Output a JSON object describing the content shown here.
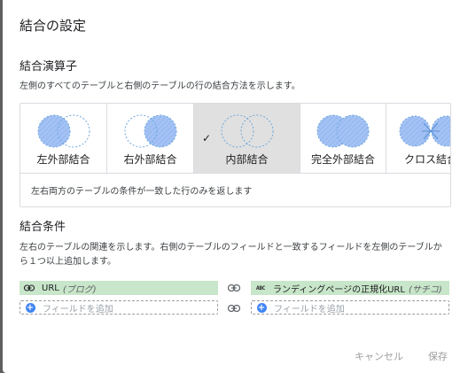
{
  "dialog": {
    "title": "結合の設定"
  },
  "operator": {
    "section_title": "結合演算子",
    "description": "左側のすべてのテーブルと右側のテーブルの行の結合方法を示します。",
    "types": [
      {
        "label": "左外部結合",
        "icon": "left-outer-join-icon",
        "selected": false
      },
      {
        "label": "右外部結合",
        "icon": "right-outer-join-icon",
        "selected": false
      },
      {
        "label": "内部結合",
        "icon": "inner-join-icon",
        "selected": true
      },
      {
        "label": "完全外部結合",
        "icon": "full-outer-join-icon",
        "selected": false
      },
      {
        "label": "クロス結合",
        "icon": "cross-join-icon",
        "selected": false
      }
    ],
    "selected_description": "左右両方のテーブルの条件が一致した行のみを返します",
    "check_mark": "✓"
  },
  "conditions": {
    "section_title": "結合条件",
    "description": "左右のテーブルの関連を示します。右側のテーブルのフィールドと一致するフィールドを左側のテーブルから１つ以上追加します。",
    "left_field": {
      "name": "URL",
      "source": "(ブログ)",
      "icon": "link-icon"
    },
    "right_field": {
      "name": "ランディングページの正規化URL",
      "source": "(サチコ)",
      "icon": "text-abc-icon"
    },
    "abc_glyph": "ABC",
    "add_field_label": "フィールドを追加",
    "plus_glyph": "+"
  },
  "footer": {
    "cancel_label": "キャンセル",
    "save_label": "保存"
  },
  "colors": {
    "selected_bg": "#e0e0e0",
    "venn_stroke": "#6fa8dc",
    "venn_fill": "#a4c2f4",
    "field_green": "#c8e6c9",
    "add_blue": "#4285f4"
  }
}
